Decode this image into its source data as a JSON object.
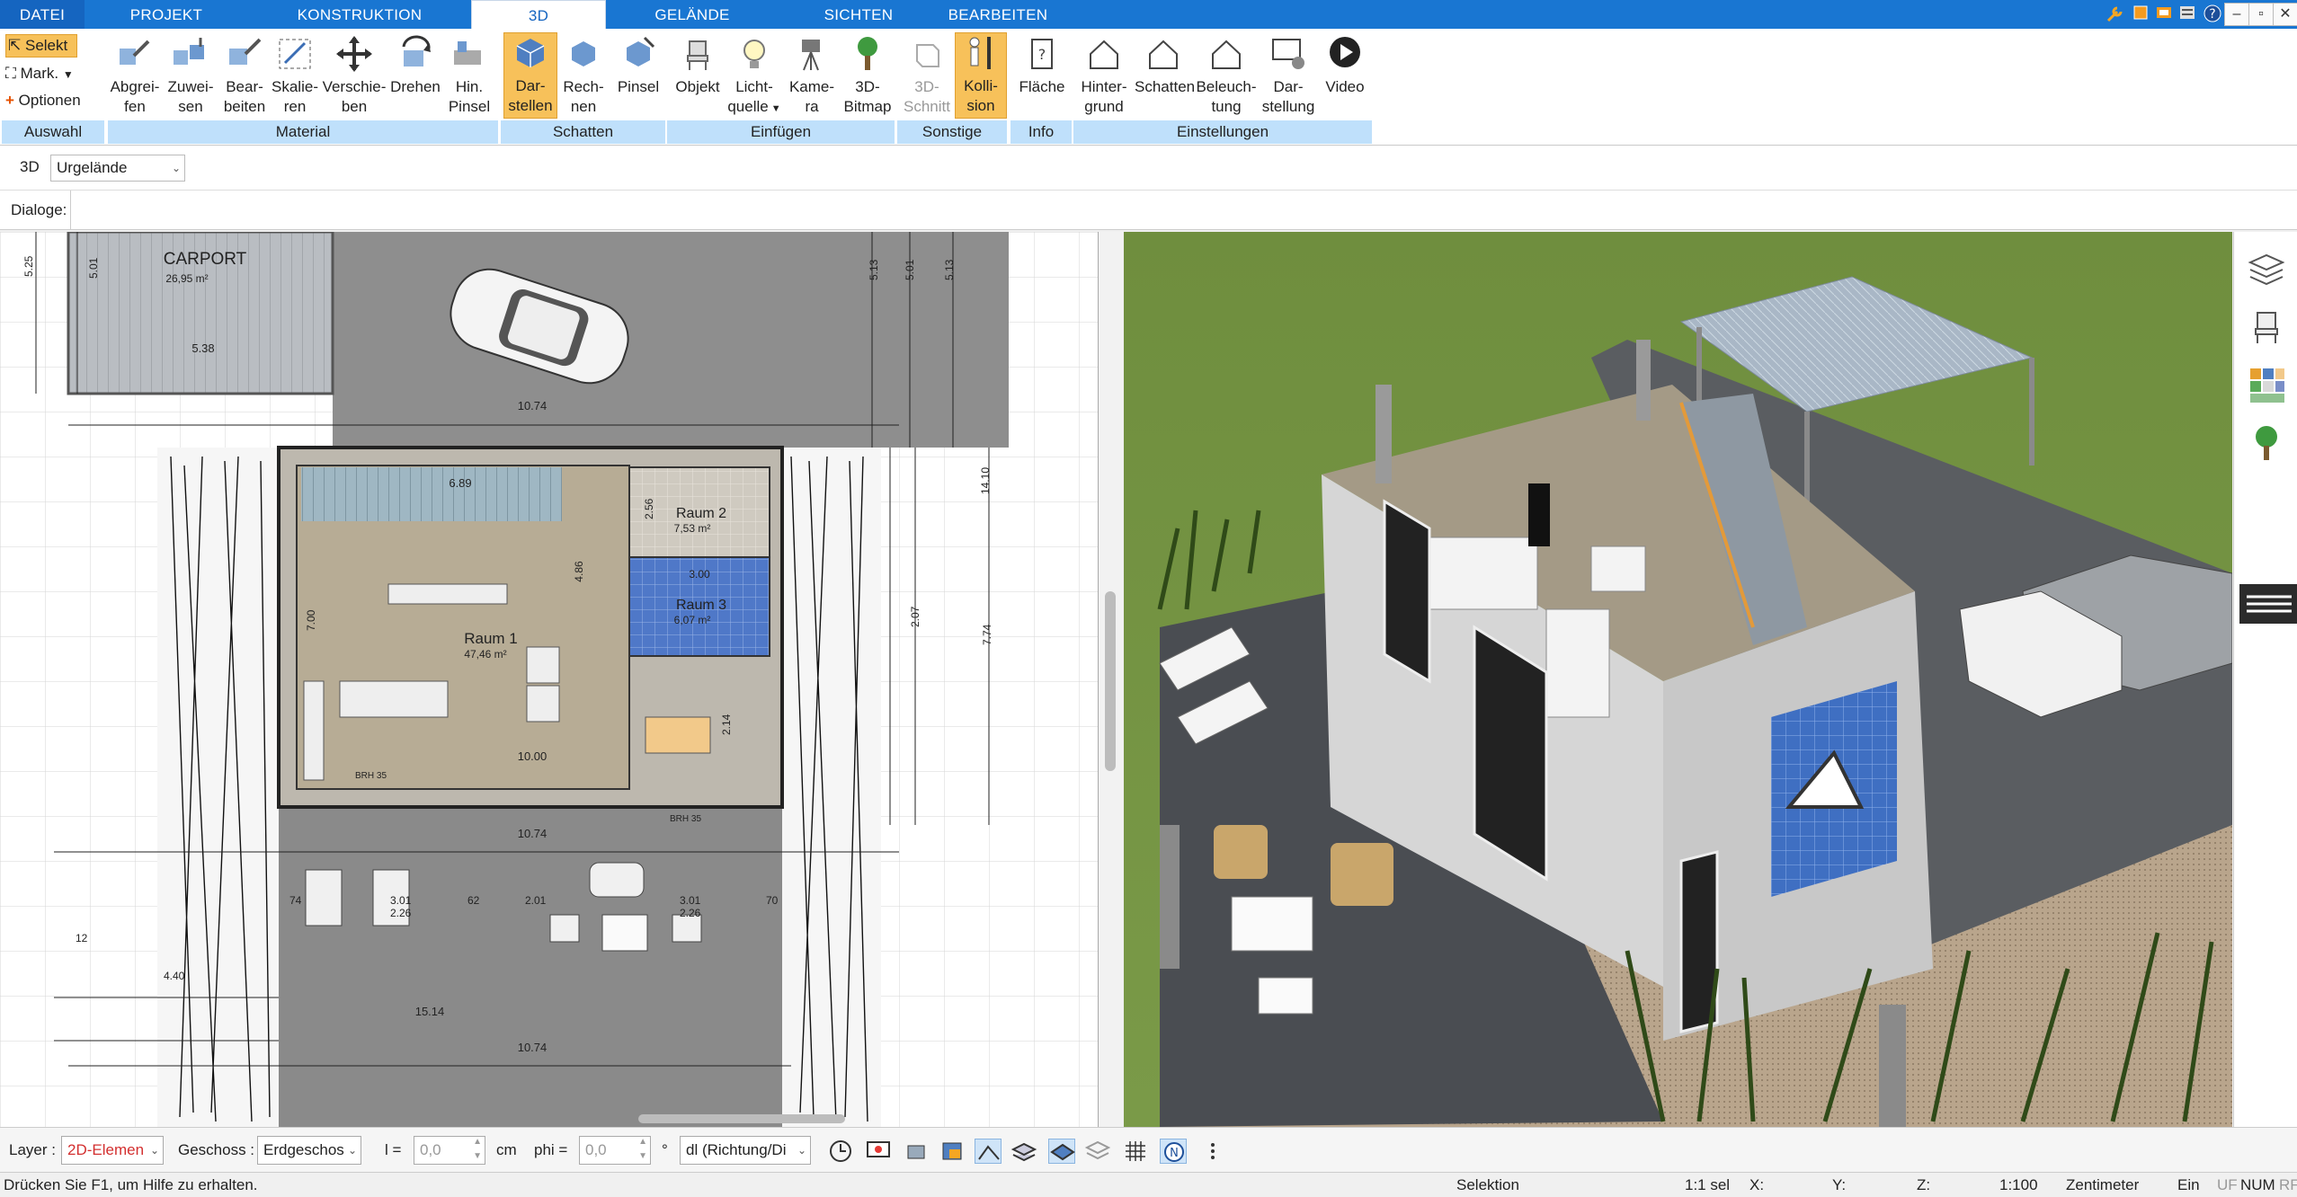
{
  "tabs": [
    {
      "id": "datei",
      "label": "DATEI"
    },
    {
      "id": "projekt",
      "label": "PROJEKT"
    },
    {
      "id": "konstruktion",
      "label": "KONSTRUKTION"
    },
    {
      "id": "3d",
      "label": "3D",
      "active": true
    },
    {
      "id": "gelaende",
      "label": "GELÄNDE"
    },
    {
      "id": "sichten",
      "label": "SICHTEN"
    },
    {
      "id": "bearbeiten",
      "label": "BEARBEITEN"
    }
  ],
  "auswahl": {
    "selekt": "Selekt",
    "mark": "Mark.",
    "optionen": "Optionen",
    "group": "Auswahl"
  },
  "ribbon": {
    "material": {
      "group": "Material",
      "buttons": [
        {
          "l1": "Abgrei-",
          "l2": "fen"
        },
        {
          "l1": "Zuwei-",
          "l2": "sen"
        },
        {
          "l1": "Bear-",
          "l2": "beiten"
        },
        {
          "l1": "Skalie-",
          "l2": "ren"
        },
        {
          "l1": "Verschie-",
          "l2": "ben"
        },
        {
          "l1": "Drehen",
          "l2": ""
        },
        {
          "l1": "Hin.",
          "l2": "Pinsel"
        }
      ]
    },
    "schatten": {
      "group": "Schatten",
      "buttons": [
        {
          "l1": "Dar-",
          "l2": "stellen"
        },
        {
          "l1": "Rech-",
          "l2": "nen"
        },
        {
          "l1": "Pinsel",
          "l2": ""
        }
      ]
    },
    "einfuegen": {
      "group": "Einfügen",
      "buttons": [
        {
          "l1": "Objekt",
          "l2": ""
        },
        {
          "l1": "Licht-",
          "l2": "quelle"
        },
        {
          "l1": "Kame-",
          "l2": "ra"
        },
        {
          "l1": "3D-",
          "l2": "Bitmap"
        }
      ]
    },
    "sonstige": {
      "group": "Sonstige",
      "buttons": [
        {
          "l1": "3D-",
          "l2": "Schnitt"
        },
        {
          "l1": "Kolli-",
          "l2": "sion"
        }
      ]
    },
    "info": {
      "group": "Info",
      "buttons": [
        {
          "l1": "Fläche",
          "l2": ""
        }
      ]
    },
    "einstellungen": {
      "group": "Einstellungen",
      "buttons": [
        {
          "l1": "Hinter-",
          "l2": "grund"
        },
        {
          "l1": "Schatten",
          "l2": ""
        },
        {
          "l1": "Beleuch-",
          "l2": "tung"
        },
        {
          "l1": "Dar-",
          "l2": "stellung"
        },
        {
          "l1": "Video",
          "l2": ""
        }
      ]
    }
  },
  "viewrow": {
    "mode": "3D",
    "select_value": "Urgelände"
  },
  "dialogrow": {
    "label": "Dialoge:"
  },
  "plan": {
    "carport": {
      "title": "CARPORT",
      "area": "26,95 m²"
    },
    "raum1": {
      "title": "Raum 1",
      "area": "47,46 m²"
    },
    "raum2": {
      "title": "Raum 2",
      "area": "7,53 m²"
    },
    "raum3": {
      "title": "Raum 3",
      "area": "6,07 m²"
    },
    "dims": {
      "d1074": "10.74",
      "d538": "5.38",
      "d525": "5.25",
      "d501": "5.01",
      "d513": "5.13",
      "d689": "6.89",
      "d486": "4.86",
      "d1000": "10.00",
      "d300": "3.00",
      "d1514": "15.14",
      "d774": "7.74",
      "d1410": "14.10",
      "d301": "3.01",
      "d226": "2.26",
      "d201": "2.01",
      "d62": "62",
      "d74": "74",
      "d70": "70",
      "d440": "4.40",
      "d12": "12",
      "d256": "2.56",
      "d214": "2.14",
      "d207": "2.07",
      "d700": "7.00",
      "brh": "BRH 35"
    }
  },
  "bottombar": {
    "layer_label": "Layer :",
    "layer_value": "2D-Elemen",
    "geschoss_label": "Geschoss :",
    "geschoss_value": "Erdgeschos",
    "l_label": "l =",
    "l_value": "0,0",
    "l_unit": "cm",
    "phi_label": "phi =",
    "phi_value": "0,0",
    "phi_unit": "°",
    "dl_value": "dl (Richtung/Di"
  },
  "statusbar": {
    "help": "Drücken Sie F1, um Hilfe zu erhalten.",
    "mode": "Selektion",
    "sel": "1:1 sel",
    "x": "X:",
    "y": "Y:",
    "z": "Z:",
    "scale": "1:100",
    "unit": "Zentimeter",
    "ein": "Ein",
    "uf": "UF",
    "num": "NUM",
    "rf": "RF"
  },
  "colors": {
    "tabbar": "#1976d2",
    "group_label": "#bfe0fb",
    "highlight": "#f7c15a",
    "grass": "#6a8c3a"
  }
}
